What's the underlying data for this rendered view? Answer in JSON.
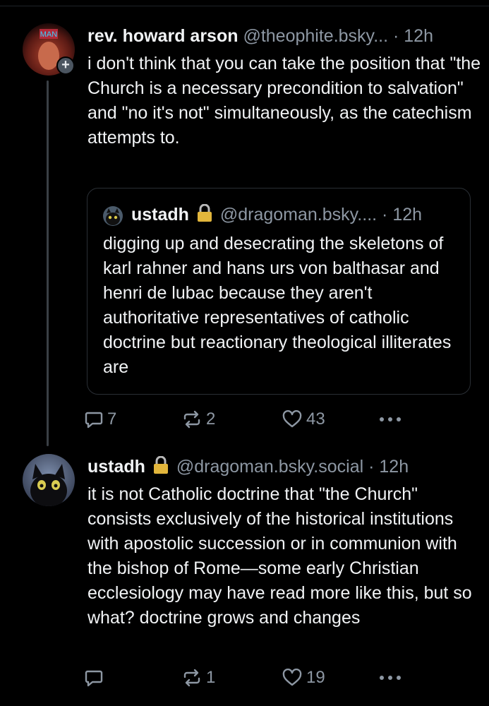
{
  "post1": {
    "author_name": "rev. howard arson",
    "handle": "@theophite.bsky...",
    "time_sep": "·",
    "time": "12h",
    "avatar_label": "MAN",
    "follow_badge": "+",
    "text": "i don't think that you can take the position that \"the Church is a necessary precondition to salvation\" and \"no it's not\" simultaneously, as the catechism attempts to.",
    "quote": {
      "author_name": "ustadh",
      "handle": "@dragoman.bsky....",
      "time_sep": "·",
      "time": "12h",
      "text": "digging up and desecrating the skeletons of karl rahner and hans urs von balthasar and henri de lubac because they aren't authoritative representatives of catholic doctrine but reactionary theological illiterates are"
    },
    "actions": {
      "replies": "7",
      "reposts": "2",
      "likes": "43"
    }
  },
  "post2": {
    "author_name": "ustadh",
    "handle": "@dragoman.bsky.social",
    "time_sep": "·",
    "time": "12h",
    "text": "it is not Catholic doctrine that \"the Church\" consists exclusively of the historical institutions with apostolic succession or in communion with the bishop of Rome—some early Christian ecclesiology may have read more like this, but so what? doctrine grows and changes",
    "actions": {
      "replies": "",
      "reposts": "1",
      "likes": "19"
    }
  },
  "icons": {
    "reply": "speech-bubble-icon",
    "repost": "repost-arrows-icon",
    "like": "heart-outline-icon",
    "more": "more-dots-icon",
    "lock": "lock-emoji-icon"
  },
  "colors": {
    "background": "#000000",
    "text": "#f1f3f5",
    "muted": "#8d97a3",
    "border": "#2a2f35",
    "thread_line": "#3a3f45"
  }
}
